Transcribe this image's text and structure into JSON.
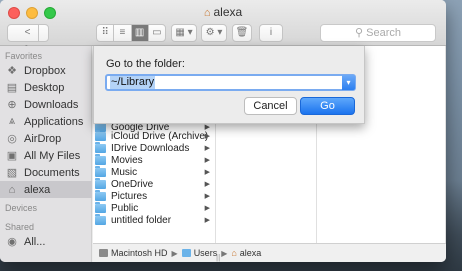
{
  "window": {
    "title": "alexa"
  },
  "toolbar": {
    "back": "<",
    "forward": ">",
    "view_icons": "⠿",
    "view_list": "≡",
    "view_columns": "▥",
    "view_gallery": "▭",
    "arrange": "▦ ▾",
    "action": "⚙ ▾",
    "share": "🗑",
    "info": "i",
    "search_placeholder": "Search"
  },
  "sidebar": {
    "favorites_label": "Favorites",
    "favorites": [
      {
        "label": "Dropbox",
        "icon": "dropbox-icon"
      },
      {
        "label": "Desktop",
        "icon": "desktop-icon"
      },
      {
        "label": "Downloads",
        "icon": "downloads-icon"
      },
      {
        "label": "Applications",
        "icon": "applications-icon"
      },
      {
        "label": "AirDrop",
        "icon": "airdrop-icon"
      },
      {
        "label": "All My Files",
        "icon": "files-icon"
      },
      {
        "label": "Documents",
        "icon": "documents-icon"
      },
      {
        "label": "alexa",
        "icon": "home-icon",
        "selected": true
      }
    ],
    "devices_label": "Devices",
    "shared_label": "Shared",
    "shared": [
      {
        "label": "All...",
        "icon": "network-icon"
      }
    ]
  },
  "columns": {
    "col1": [
      "Google Drive",
      "iCloud Drive (Archive)",
      "IDrive Downloads",
      "Movies",
      "Music",
      "OneDrive",
      "Pictures",
      "Public",
      "untitled folder"
    ]
  },
  "pathbar": {
    "items": [
      "Macintosh HD",
      "Users",
      "alexa"
    ]
  },
  "goto_sheet": {
    "label": "Go to the folder:",
    "value": "~/Library",
    "cancel": "Cancel",
    "go": "Go"
  },
  "colors": {
    "accent": "#2c7ff0",
    "selection": "#b4d3f7",
    "folder": "#6bb3e9"
  }
}
